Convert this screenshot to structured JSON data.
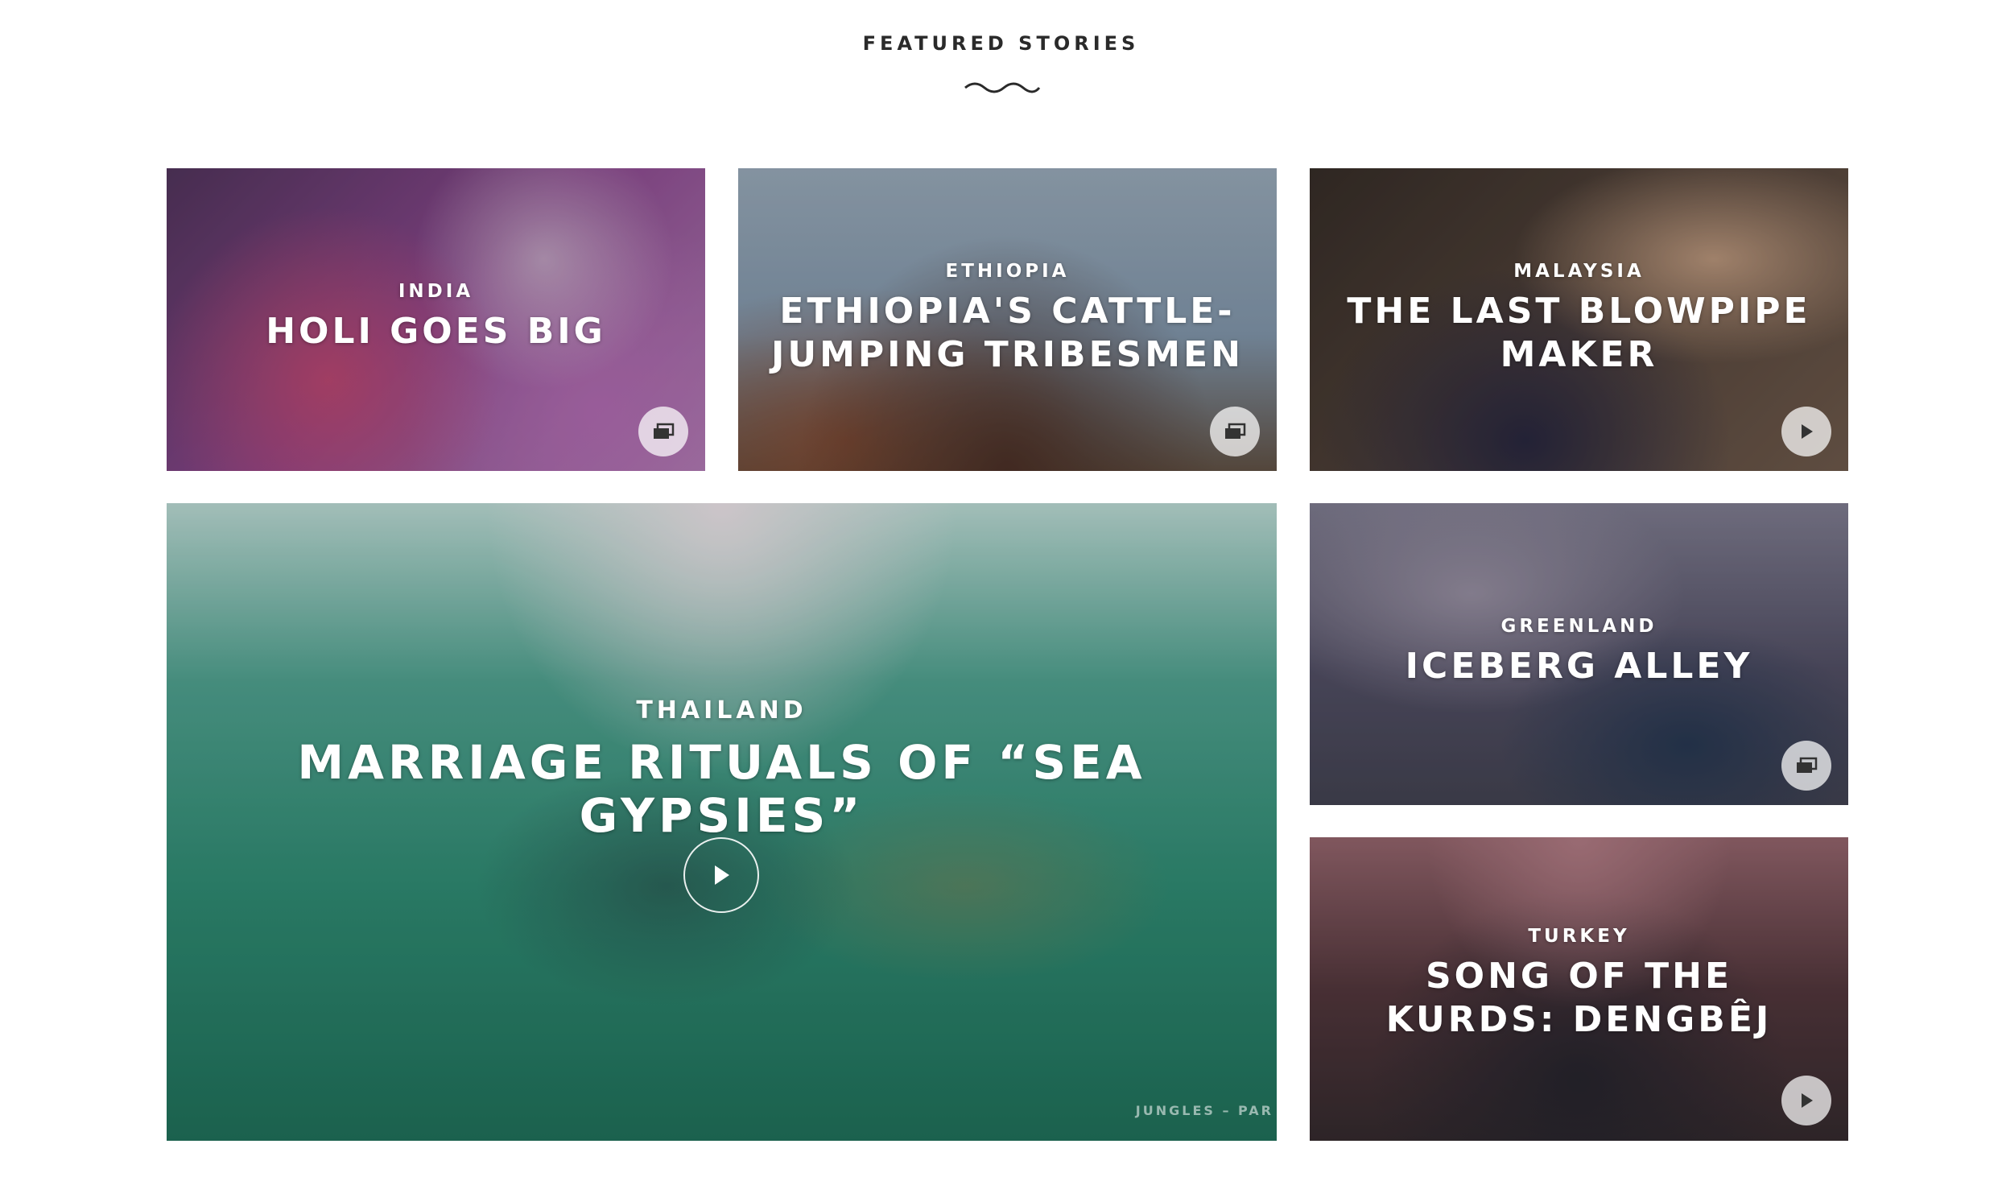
{
  "section": {
    "title": "FEATURED STORIES"
  },
  "cards": [
    {
      "country": "INDIA",
      "title": "HOLI GOES BIG",
      "media_icon": "gallery-icon"
    },
    {
      "country": "ETHIOPIA",
      "title": "ETHIOPIA'S CATTLE-JUMPING TRIBESMEN",
      "media_icon": "gallery-icon"
    },
    {
      "country": "MALAYSIA",
      "title": "THE LAST BLOWPIPE MAKER",
      "media_icon": "play-icon"
    },
    {
      "country": "THAILAND",
      "title": "MARRIAGE RITUALS OF “SEA GYPSIES”",
      "media_icon": "play-icon",
      "watermark": "JUNGLES – PAR"
    },
    {
      "country": "GREENLAND",
      "title": "ICEBERG ALLEY",
      "media_icon": "gallery-icon"
    },
    {
      "country": "TURKEY",
      "title": "SONG OF THE KURDS: DENGBÊJ",
      "media_icon": "play-icon"
    }
  ],
  "colors": {
    "india": "#9a4f9e",
    "ethiopia": "#8fa6bd",
    "malaysia": "#5b4a40",
    "thailand": "#2f8a72",
    "greenland": "#5b5870",
    "turkey": "#5c3d43"
  }
}
